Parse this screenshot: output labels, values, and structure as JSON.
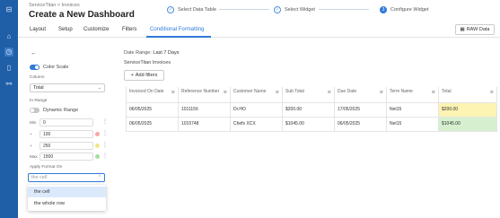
{
  "nav": {
    "icons": [
      "app-logo-icon",
      "home-icon",
      "dashboard-icon",
      "document-icon",
      "link-icon"
    ]
  },
  "header": {
    "breadcrumb": "ServiceTitan  >  Invoices",
    "title": "Create a New Dashboard"
  },
  "steps": [
    {
      "num": "✓",
      "label": "Select Data Table"
    },
    {
      "num": "✓",
      "label": "Select Widget"
    },
    {
      "num": "3",
      "label": "Configure Widget"
    }
  ],
  "tabs": [
    "Layout",
    "Setup",
    "Customize",
    "Filters",
    "Conditional Formatting"
  ],
  "active_tab": "Conditional Formatting",
  "raw_data_label": "RAW Data",
  "panel": {
    "color_scale_label": "Color Scale",
    "column_label": "Column",
    "column_value": "Total",
    "in_range_label": "In Range",
    "dynamic_range_label": "Dynamic Range",
    "ranges": [
      {
        "label": "Min",
        "value": "0",
        "color": ""
      },
      {
        "label": "+",
        "value": "100",
        "color": "#f4a6a6"
      },
      {
        "label": "+",
        "value": "250",
        "color": "#f6e48a"
      },
      {
        "label": "Max",
        "value": "1500",
        "color": "#a6dca0"
      }
    ],
    "apply_label": "Apply Format On",
    "apply_placeholder": "the cell",
    "options": [
      "the cell",
      "the whole row"
    ],
    "selected_option": "the cell"
  },
  "main": {
    "date_range_label": "Date Range:",
    "date_range_value": "Last 7 Days",
    "table_title": "ServiceTitan Invoices",
    "add_filters_label": "Add filters",
    "columns": [
      "Invoiced On Date",
      "Reference Number",
      "Customer Name",
      "Sub Total",
      "Due Date",
      "Term Name",
      "Total"
    ],
    "rows": [
      [
        "06/05/2025",
        "1011156",
        "Dr.HO",
        "$200.00",
        "17/05/2025",
        "Net15",
        "$200.00"
      ],
      [
        "06/05/2025",
        "1015748",
        "Chefs XCX",
        "$1045.00",
        "06/05/2025",
        "Net15",
        "$1045.00"
      ]
    ],
    "total_colors": [
      "#fdf3b3",
      "#d6f0cf"
    ]
  }
}
